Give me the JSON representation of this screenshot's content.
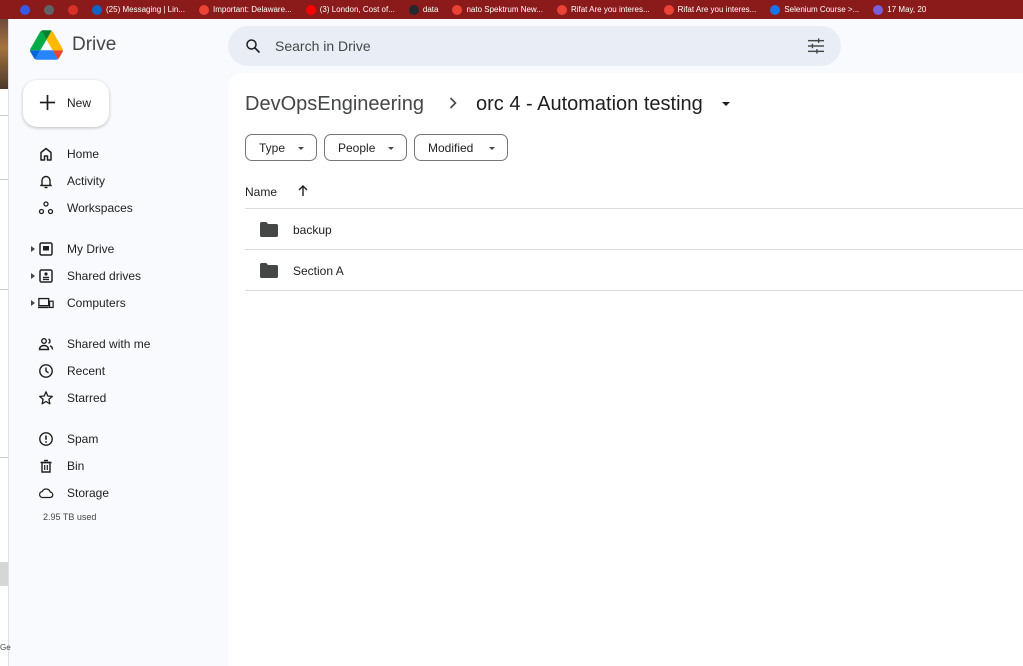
{
  "bookmarks": [
    {
      "label": "",
      "icon": "wordpress-icon",
      "color": "#3858e9"
    },
    {
      "label": "",
      "icon": "extension-icon",
      "color": "#5f6368"
    },
    {
      "label": "",
      "icon": "heart-icon",
      "color": "#d93025"
    },
    {
      "label": "(25) Messaging | Lin...",
      "icon": "linkedin-icon",
      "color": "#0a66c2"
    },
    {
      "label": "Important: Delaware...",
      "icon": "gmail-icon",
      "color": "#ea4335"
    },
    {
      "label": "(3) London, Cost of...",
      "icon": "youtube-icon",
      "color": "#ff0000"
    },
    {
      "label": "data",
      "icon": "github-icon",
      "color": "#24292f"
    },
    {
      "label": "nato Spektrum New...",
      "icon": "gmail-icon",
      "color": "#ea4335"
    },
    {
      "label": "Rifat Are you interes...",
      "icon": "gmail-icon",
      "color": "#ea4335"
    },
    {
      "label": "Rifat Are you interes...",
      "icon": "gmail-icon",
      "color": "#ea4335"
    },
    {
      "label": "Selenium Course >...",
      "icon": "shield-icon",
      "color": "#1a73e8"
    },
    {
      "label": "17 May, 20",
      "icon": "gear-icon",
      "color": "#7b5fd6"
    }
  ],
  "sliver_text": "Ge",
  "app": {
    "title": "Drive"
  },
  "search": {
    "placeholder": "Search in Drive",
    "value": ""
  },
  "new_button": {
    "label": "New"
  },
  "nav": {
    "home": "Home",
    "activity": "Activity",
    "workspaces": "Workspaces",
    "my_drive": "My Drive",
    "shared_drives": "Shared drives",
    "computers": "Computers",
    "shared_with_me": "Shared with me",
    "recent": "Recent",
    "starred": "Starred",
    "spam": "Spam",
    "bin": "Bin",
    "storage": "Storage",
    "storage_used": "2.95 TB used"
  },
  "breadcrumb": {
    "root": "DevOpsEngineering",
    "current": "orc 4 - Automation testing"
  },
  "filters": {
    "type": "Type",
    "people": "People",
    "modified": "Modified"
  },
  "table": {
    "column_name": "Name",
    "rows": [
      {
        "name": "backup"
      },
      {
        "name": "Section A"
      }
    ]
  },
  "colors": {
    "accent": "#0b57d0",
    "search_bg": "#e9eef6",
    "page_bg": "#f8fafd",
    "bookmarks_bg": "#8b1a1a"
  }
}
